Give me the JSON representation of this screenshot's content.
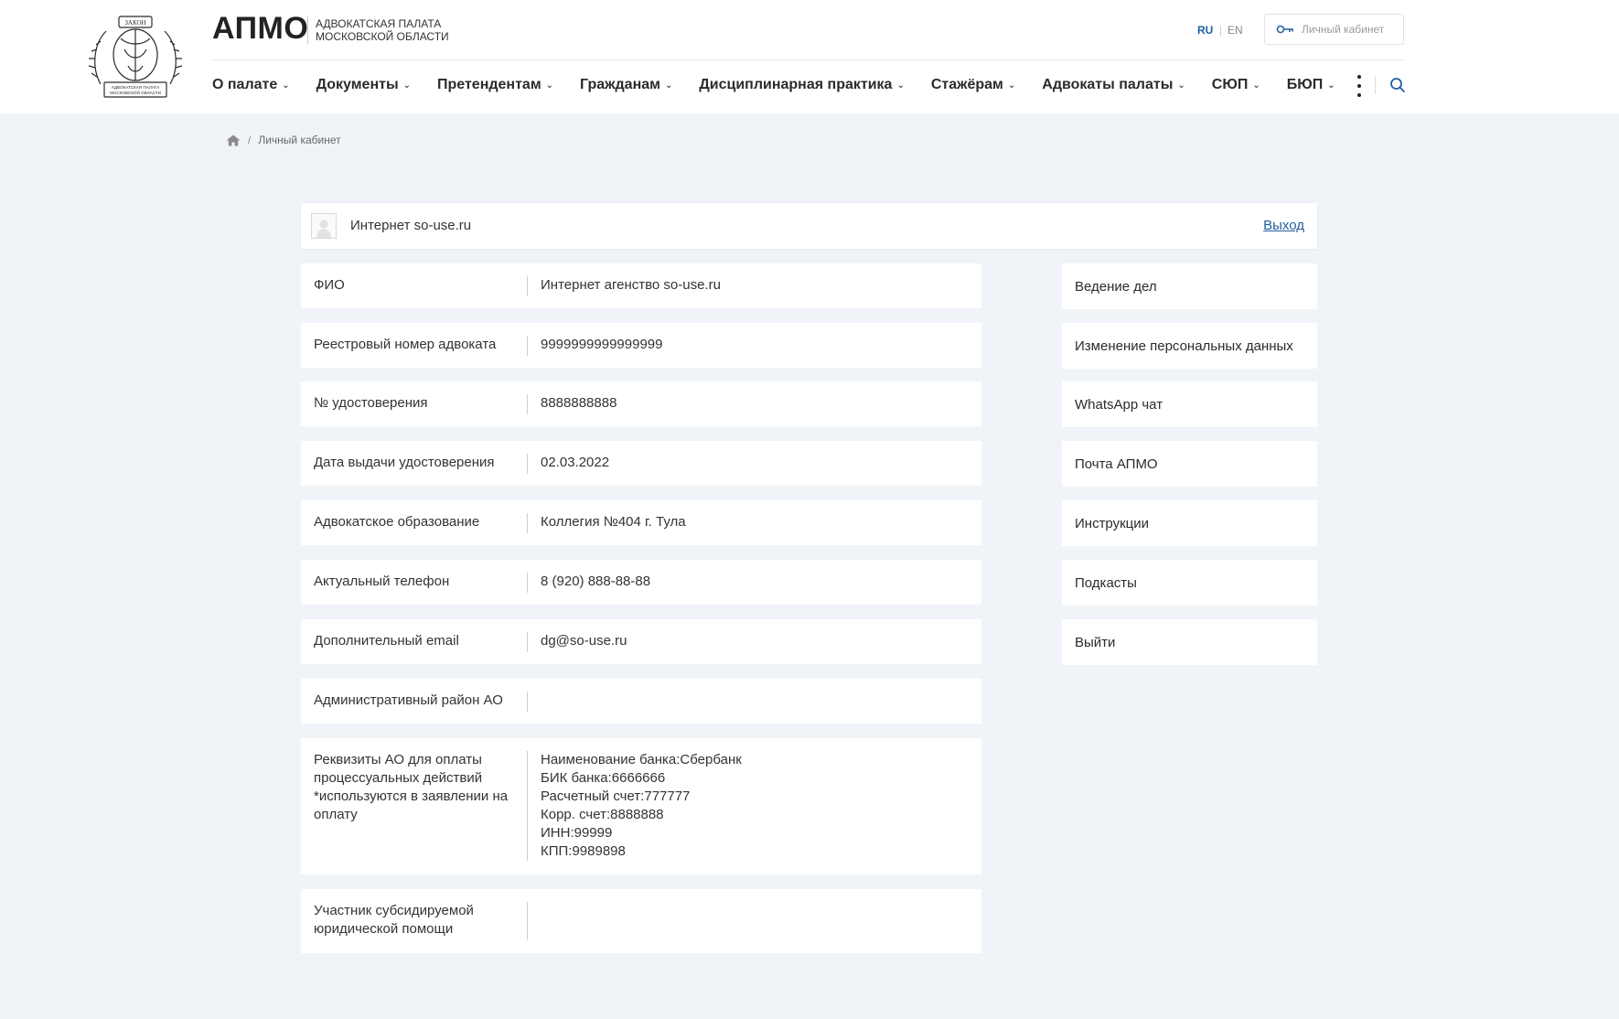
{
  "header": {
    "brand_name": "АПМО",
    "brand_sub_line1": "АДВОКАТСКАЯ ПАЛАТА",
    "brand_sub_line2": "МОСКОВСКОЙ ОБЛАСТИ",
    "emblem_text_top": "ЗАКОН",
    "emblem_text_bottom1": "АДВОКАТСКАЯ ПАЛАТА",
    "emblem_text_bottom2": "МОСКОВСКОЙ ОБЛАСТИ",
    "lang_ru": "RU",
    "lang_sep": "|",
    "lang_en": "EN",
    "cabinet_label": "Личный кабинет",
    "nav": [
      {
        "label": "О палате"
      },
      {
        "label": "Документы"
      },
      {
        "label": "Претендентам"
      },
      {
        "label": "Гражданам"
      },
      {
        "label": "Дисциплинарная практика"
      },
      {
        "label": "Стажёрам"
      },
      {
        "label": "Адвокаты палаты"
      },
      {
        "label": "СЮП"
      },
      {
        "label": "БЮП"
      }
    ]
  },
  "breadcrumb": {
    "separator": "/",
    "current": "Личный кабинет"
  },
  "user_bar": {
    "name": "Интернет so-use.ru",
    "logout": "Выход"
  },
  "info": [
    {
      "label": "ФИО",
      "value": "Интернет агенство so-use.ru"
    },
    {
      "label": "Реестровый номер адвоката",
      "value": "9999999999999999"
    },
    {
      "label": "№ удостоверения",
      "value": "8888888888"
    },
    {
      "label": "Дата выдачи удостоверения",
      "value": "02.03.2022"
    },
    {
      "label": "Адвокатское образование",
      "value": "Коллегия №404 г. Тула"
    },
    {
      "label": "Актуальный телефон",
      "value": "8 (920) 888-88-88"
    },
    {
      "label": "Дополнительный email",
      "value": "dg@so-use.ru"
    },
    {
      "label": "Административный район АО",
      "value": ""
    },
    {
      "label_lines": [
        "Реквизиты АО для оплаты",
        "процессуальных действий",
        "*используются в заявлении на",
        "оплату"
      ],
      "value_lines": [
        "Наименование банка:Сбербанк",
        "БИК банка:6666666",
        "Расчетный счет:777777",
        "Корр. счет:8888888",
        "ИНН:99999",
        "КПП:9989898"
      ]
    },
    {
      "label_lines": [
        "Участник субсидируемой",
        "юридической помощи"
      ],
      "value": ""
    }
  ],
  "side_menu": [
    {
      "label": "Ведение дел"
    },
    {
      "label": "Изменение персональных данных"
    },
    {
      "label": "WhatsApp чат"
    },
    {
      "label": "Почта АПМО"
    },
    {
      "label": "Инструкции"
    },
    {
      "label": "Подкасты"
    },
    {
      "label": "Выйти"
    }
  ],
  "colors": {
    "accent": "#1f5f9f",
    "page_bg": "#f0f4f8",
    "card_bg": "#ffffff"
  },
  "icons": {
    "emblem": "chamber-emblem-icon",
    "key": "key-icon",
    "chevron": "chevron-down-icon",
    "more": "more-vertical-icon",
    "search": "search-icon",
    "home": "home-icon",
    "avatar": "user-avatar-icon"
  }
}
